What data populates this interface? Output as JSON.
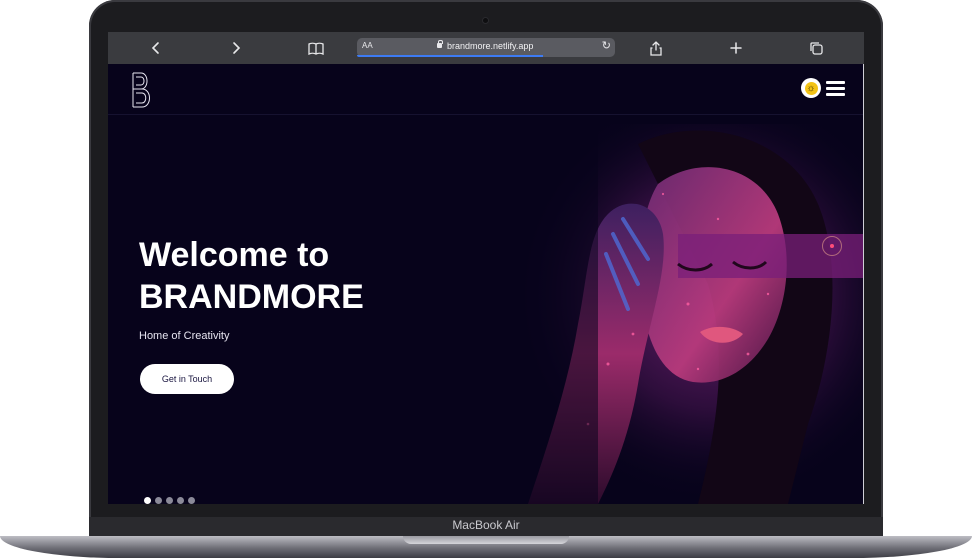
{
  "device": {
    "label": "MacBook Air"
  },
  "browser": {
    "address_small_text": "AA",
    "url": "brandmore.netlify.app",
    "page_load_progress": 0.72
  },
  "site": {
    "logo_letter": "B",
    "hero": {
      "title_line1": "Welcome to",
      "title_line2": "BRANDMORE",
      "subtitle": "Home of Creativity",
      "cta_label": "Get in Touch"
    },
    "slider": {
      "count": 5,
      "active_index": 0
    }
  },
  "colors": {
    "background": "#07031b",
    "accent": "#b5308a",
    "toggle": "#f3c316"
  },
  "icons": [
    "back-icon",
    "forward-icon",
    "bookmarks-icon",
    "lock-icon",
    "reload-icon",
    "share-icon",
    "new-tab-icon",
    "tabs-icon",
    "sun-icon",
    "hamburger-menu-icon"
  ]
}
